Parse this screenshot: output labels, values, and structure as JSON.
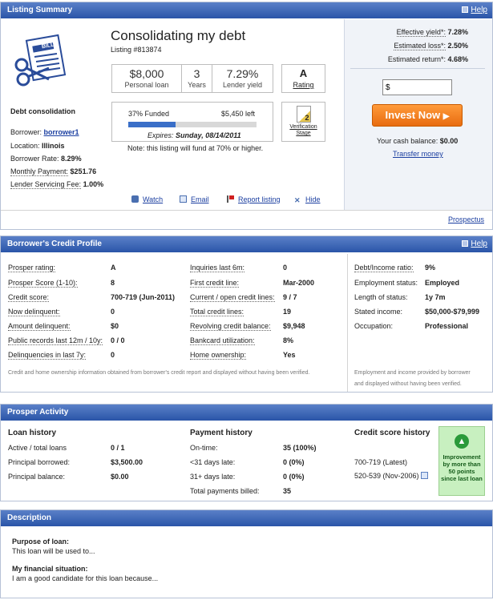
{
  "summary": {
    "header": "Listing Summary",
    "help": "Help",
    "title": "Consolidating my debt",
    "listing_no": "Listing #813874",
    "category": "Debt consolidation",
    "bill_label": "BILL",
    "borrower_label": "Borrower:",
    "borrower_value": "borrower1",
    "location_label": "Location:",
    "location_value": "Illinois",
    "rate_label": "Borrower Rate:",
    "rate_value": "8.29%",
    "monthly_label": "Monthly Payment:",
    "monthly_value": "$251.76",
    "fee_label": "Lender Servicing Fee:",
    "fee_value": "1.00%",
    "stats": {
      "amount": "$8,000",
      "amount_label": "Personal loan",
      "term": "3",
      "term_label": "Years",
      "yield": "7.29%",
      "yield_label": "Lender yield",
      "rating": "A",
      "rating_label": "Rating"
    },
    "funded_pct_text": "37% Funded",
    "funded_fraction": 0.37,
    "left": "$5,450 left",
    "expires_prefix": "Expires:",
    "expires_date": "Sunday, 08/14/2011",
    "fund_note": "Note: this listing will fund at 70% or higher.",
    "verification_num": "2",
    "verification_label": "Verification Stage",
    "actions": {
      "watch": "Watch",
      "email": "Email",
      "report": "Report listing",
      "hide": "Hide"
    },
    "prospectus": "Prospectus",
    "right": {
      "eff_label": "Effective yield*:",
      "eff_value": "7.28%",
      "loss_label": "Estimated loss*:",
      "loss_value": "2.50%",
      "ret_label": "Estimated return*:",
      "ret_value": "4.68%",
      "amount_value": "$",
      "invest_button": "Invest Now",
      "cash_label": "Your cash balance:",
      "cash_value": "$0.00",
      "transfer": "Transfer money"
    }
  },
  "credit": {
    "header": "Borrower's Credit Profile",
    "help": "Help",
    "col1": [
      {
        "label": "Prosper rating:",
        "value": "A"
      },
      {
        "label": "Prosper Score (1-10):",
        "value": "8"
      },
      {
        "label": "Credit score:",
        "value": "700-719 (Jun-2011)"
      },
      {
        "label": "Now delinquent:",
        "value": "0"
      },
      {
        "label": "Amount delinquent:",
        "value": "$0"
      },
      {
        "label": "Public records last 12m / 10y:",
        "value": "0 / 0"
      },
      {
        "label": "Delinquencies in last 7y:",
        "value": "0"
      }
    ],
    "col2": [
      {
        "label": "Inquiries last 6m:",
        "value": "0"
      },
      {
        "label": "First credit line:",
        "value": "Mar-2000"
      },
      {
        "label": "Current / open credit lines:",
        "value": "9 / 7"
      },
      {
        "label": "Total credit lines:",
        "value": "19"
      },
      {
        "label": "Revolving credit balance:",
        "value": "$9,948"
      },
      {
        "label": "Bankcard utilization:",
        "value": "8%"
      },
      {
        "label": "Home ownership:",
        "value": "Yes"
      }
    ],
    "col3": [
      {
        "label": "Debt/Income ratio:",
        "value": "9%"
      },
      {
        "label": "Employment status:",
        "value": "Employed"
      },
      {
        "label": "Length of status:",
        "value": "1y 7m"
      },
      {
        "label": "Stated income:",
        "value": "$50,000-$79,999"
      },
      {
        "label": "Occupation:",
        "value": "Professional"
      }
    ],
    "note_left": "Credit and home ownership information obtained from borrower's credit report and displayed without having been verified.",
    "note_right_1": "Employment and income provided by borrower",
    "note_right_2": "and displayed without having been verified."
  },
  "activity": {
    "header": "Prosper Activity",
    "loan_title": "Loan history",
    "loan_rows": [
      {
        "label": "Active / total loans",
        "value": "0 / 1"
      },
      {
        "label": "Principal borrowed:",
        "value": "$3,500.00"
      },
      {
        "label": "Principal balance:",
        "value": "$0.00"
      }
    ],
    "pay_title": "Payment history",
    "pay_rows": [
      {
        "label": "On-time:",
        "value": "35 (100%)"
      },
      {
        "label": "<31 days late:",
        "value": "0 (0%)"
      },
      {
        "label": "31+ days late:",
        "value": "0 (0%)"
      },
      {
        "label": "Total payments billed:",
        "value": "35"
      }
    ],
    "score_title": "Credit score history",
    "score_latest": "700-719 (Latest)",
    "score_prev": "520-539 (Nov-2006)",
    "improve_text": "Improvement by more than 50 points since last loan"
  },
  "description": {
    "header": "Description",
    "purpose_title": "Purpose of loan:",
    "purpose_text": "This loan will be used to...",
    "situation_title": "My financial situation:",
    "situation_text": "I am a good candidate for this loan because..."
  },
  "colors": {
    "header": "#2a55a8",
    "invest": "#f07c1c",
    "funded_bar": "#3a6fc8",
    "improve_bg": "#c8f0c0"
  }
}
